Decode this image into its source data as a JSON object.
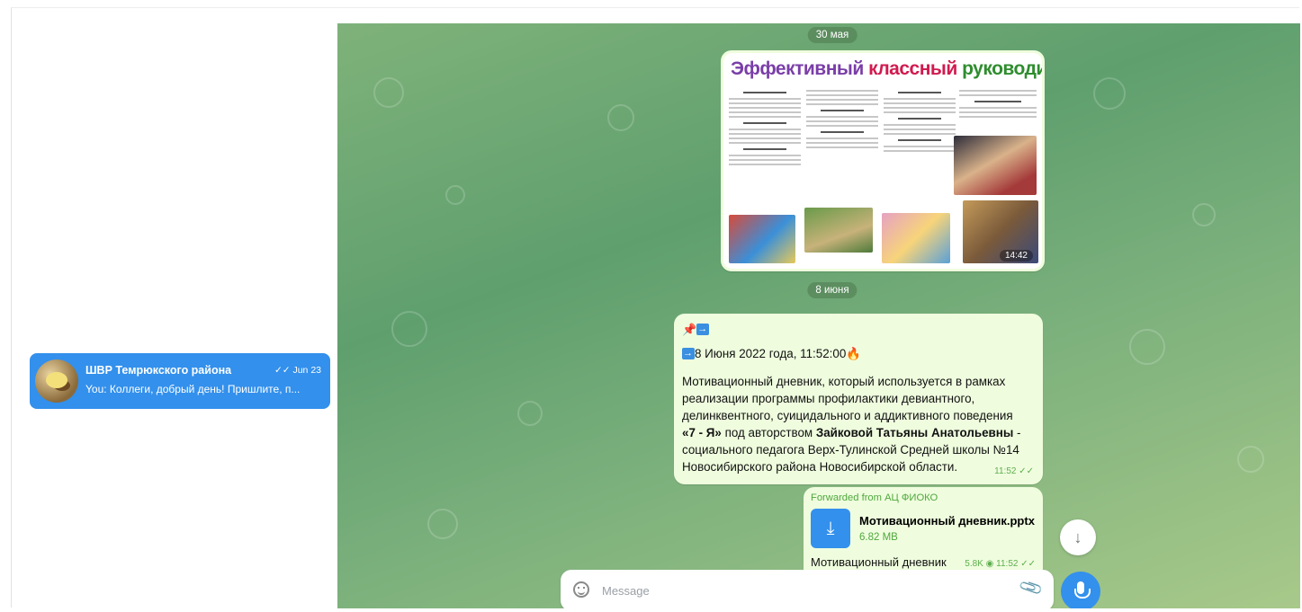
{
  "sidebar": {
    "chat": {
      "title": "ШВР Темрюкского района",
      "time": "Jun 23",
      "check": "✓✓",
      "preview": "You: Коллеги, добрый день! Пришлите, п..."
    }
  },
  "chat": {
    "date1": "30 мая",
    "date2": "8 июня",
    "poster": {
      "title_part1": "Эффективный",
      "title_part2": "классный",
      "title_part3": "руководитель",
      "time": "14:42"
    },
    "message": {
      "date_line": "8 Июня 2022 года, 11:52:00",
      "line1": "Мотивационный дневник, который используется в рамках",
      "line2": "реализации программы профилактики девиантного,",
      "line3": "делинквентного, суицидального и аддиктивного поведения",
      "bold1": "«7 - Я»",
      "mid": " под авторством ",
      "bold2": "Зайковой Татьяны Анатольевны",
      "tail": " -",
      "line5": "социального педагога Верх-Тулинской Средней школы №14",
      "line6": "Новосибирского района Новосибирской области.",
      "time": "11:52"
    },
    "forwarded": {
      "label": "Forwarded from АЦ ФИОКО",
      "file_name": "Мотивационный дневник.pptx",
      "file_size": "6.82 MB",
      "caption": "Мотивационный дневник",
      "views": "5.8K",
      "time": "11:52"
    },
    "composer": {
      "placeholder": "Message"
    }
  }
}
